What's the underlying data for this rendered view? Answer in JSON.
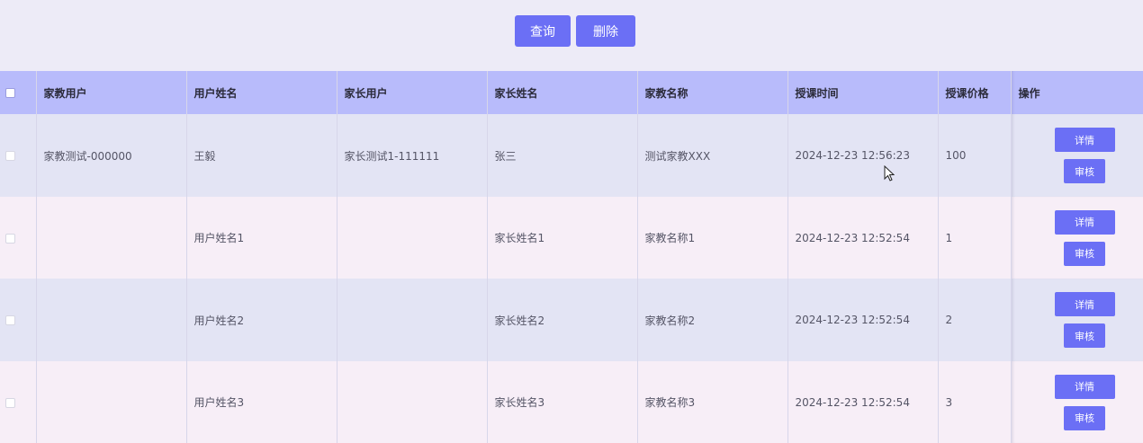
{
  "toolbar": {
    "query_label": "查询",
    "delete_label": "删除"
  },
  "table": {
    "headers": [
      "家教用户",
      "用户姓名",
      "家长用户",
      "家长姓名",
      "家教名称",
      "授课时间",
      "授课价格",
      "操作"
    ],
    "rows": [
      {
        "tutor_user": "家教测试-000000",
        "user_name": "王毅",
        "parent_user": "家长测试1-111111",
        "parent_name": "张三",
        "tutor_name": "测试家教XXX",
        "time": "2024-12-23 12:56:23",
        "price": "100"
      },
      {
        "tutor_user": "",
        "user_name": "用户姓名1",
        "parent_user": "",
        "parent_name": "家长姓名1",
        "tutor_name": "家教名称1",
        "time": "2024-12-23 12:52:54",
        "price": "1"
      },
      {
        "tutor_user": "",
        "user_name": "用户姓名2",
        "parent_user": "",
        "parent_name": "家长姓名2",
        "tutor_name": "家教名称2",
        "time": "2024-12-23 12:52:54",
        "price": "2"
      },
      {
        "tutor_user": "",
        "user_name": "用户姓名3",
        "parent_user": "",
        "parent_name": "家长姓名3",
        "tutor_name": "家教名称3",
        "time": "2024-12-23 12:52:54",
        "price": "3"
      }
    ],
    "detail_label": "详情",
    "review_label": "审核"
  },
  "colors": {
    "accent": "#6b6ff5",
    "header_bg": "#b8bbfb",
    "row_odd": "#e3e4f4",
    "row_even": "#f7eef7",
    "page_bg": "#edebf7"
  },
  "icons": {
    "cursor": "mouse-pointer-icon"
  }
}
